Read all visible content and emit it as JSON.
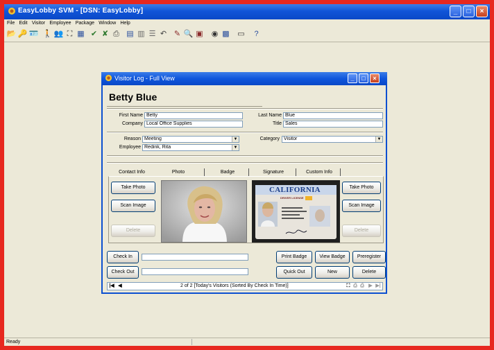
{
  "app": {
    "title": "EasyLobby SVM - [DSN: EasyLobby]",
    "minimize": "_",
    "maximize": "□",
    "close": "×"
  },
  "menu": [
    "File",
    "Edit",
    "Visitor",
    "Employee",
    "Package",
    "Window",
    "Help"
  ],
  "toolbar": [
    {
      "name": "open-icon",
      "glyph": "📂",
      "color": "#c49a2a"
    },
    {
      "name": "key-icon",
      "glyph": "🔑",
      "color": "#d8b02b"
    },
    {
      "name": "badge-icon",
      "glyph": "🪪",
      "color": "#6a6a6a"
    },
    {
      "name": "walk-icon",
      "glyph": "🚶",
      "color": "#b23b1b"
    },
    {
      "name": "people-icon",
      "glyph": "👥",
      "color": "#c23b1b"
    },
    {
      "name": "binoculars-icon",
      "glyph": "⛶",
      "color": "#333"
    },
    {
      "name": "grid-icon",
      "glyph": "▦",
      "color": "#2a4f9e"
    },
    {
      "name": "checkin-icon",
      "glyph": "✔",
      "color": "#2f7a2f"
    },
    {
      "name": "checkout-icon",
      "glyph": "✘",
      "color": "#2f7a2f"
    },
    {
      "name": "printer-icon",
      "glyph": "⎙",
      "color": "#444"
    },
    {
      "name": "calendar-icon",
      "glyph": "▤",
      "color": "#2a4f9e"
    },
    {
      "name": "form-icon",
      "glyph": "▥",
      "color": "#6c6c6c"
    },
    {
      "name": "list-icon",
      "glyph": "☰",
      "color": "#6c6c6c"
    },
    {
      "name": "undo-icon",
      "glyph": "↶",
      "color": "#444"
    },
    {
      "name": "tools-icon",
      "glyph": "✎",
      "color": "#8a2a2a"
    },
    {
      "name": "search-icon",
      "glyph": "🔍",
      "color": "#333"
    },
    {
      "name": "report-icon",
      "glyph": "▣",
      "color": "#8a2a2a"
    },
    {
      "name": "camera-icon",
      "glyph": "◉",
      "color": "#333"
    },
    {
      "name": "id-scan-icon",
      "glyph": "▩",
      "color": "#2a4f9e"
    },
    {
      "name": "package-icon",
      "glyph": "▭",
      "color": "#333"
    },
    {
      "name": "help-icon",
      "glyph": "?",
      "color": "#2a4f9e"
    }
  ],
  "status": "Ready",
  "dialog": {
    "title": "Visitor Log - Full View",
    "visitor_name": "Betty Blue",
    "first_name_label": "First Name",
    "first_name": "Betty",
    "last_name_label": "Last Name",
    "last_name": "Blue",
    "company_label": "Company",
    "company": "Local Office Supplies",
    "title_label": "Title",
    "title_value": "Sales",
    "reason_label": "Reason",
    "reason": "Meeting",
    "category_label": "Category",
    "category": "Visitor",
    "employee_label": "Employee",
    "employee": "Redink, Rita",
    "tabs": [
      "Contact Info",
      "Photo",
      "Badge",
      "Signature",
      "Custom Info"
    ],
    "take_photo": "Take Photo",
    "scan_image": "Scan Image",
    "delete": "Delete",
    "check_in": "Check In",
    "check_out": "Check Out",
    "print_badge": "Print Badge",
    "view_badge": "View Badge",
    "preregister": "Preregister",
    "quick_out": "Quick Out",
    "new": "New",
    "delete_record": "Delete",
    "record_status": "2 of 2 [Today's Visitors (Sorted By Check In Time)]",
    "license": {
      "state": "CALIFORNIA",
      "type": "DRIVER LICENSE"
    }
  }
}
